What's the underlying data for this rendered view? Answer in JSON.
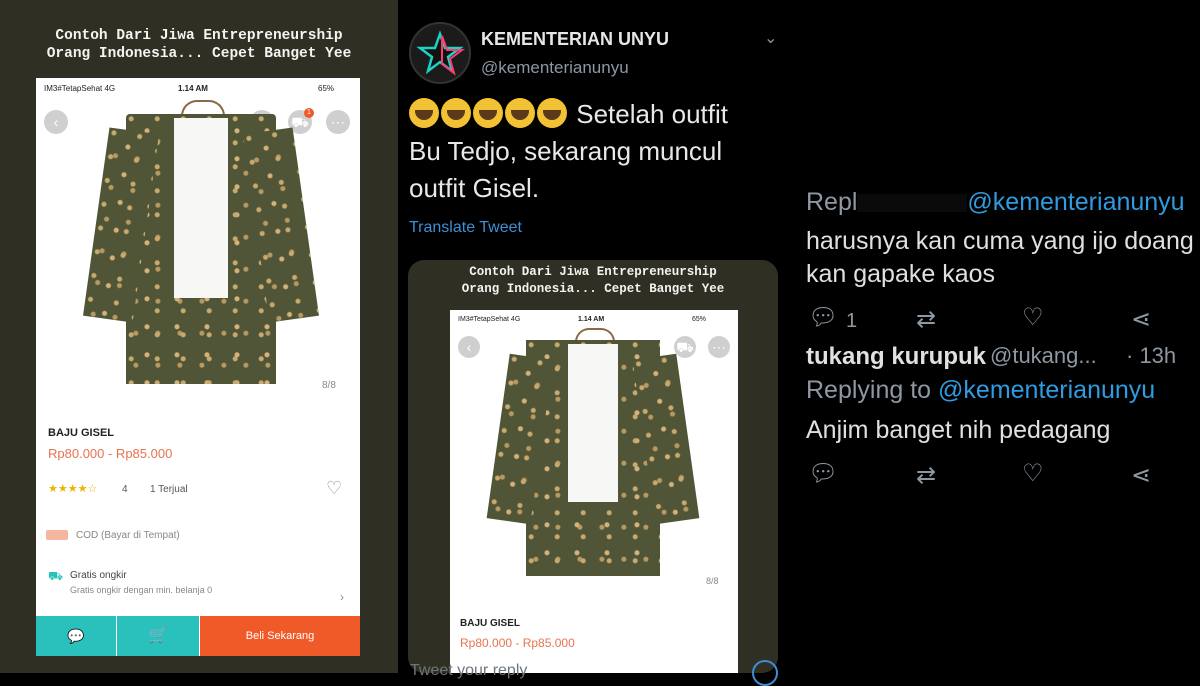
{
  "meme_title": "Contoh Dari Jiwa Entrepreneurship\nOrang Indonesia... Cepet Banget Yee",
  "phone": {
    "status_left": "IM3#TetapSehat  4G",
    "status_time": "1.14 AM",
    "status_battery": "65%",
    "cart_badge": "1",
    "image_index": "8/8",
    "product_name": "BAJU GISEL",
    "price_range": "Rp80.000 - Rp85.000",
    "rating_stars": "★★★★☆",
    "rating_value": "4",
    "sold_count": "1 Terjual",
    "cod_label": "COD (Bayar di Tempat)",
    "free_shipping_title": "Gratis ongkir",
    "free_shipping_desc": "Gratis ongkir dengan min. belanja 0",
    "buy_now_label": "Beli Sekarang",
    "accent": "#f05a28",
    "teal": "#2ac1bc"
  },
  "tweet": {
    "display_name": "KEMENTERIAN UNYU",
    "handle": "@kementerianunyu",
    "text_line1": "Setelah outfit",
    "text_line2": "Bu Tedjo, sekarang muncul",
    "text_line3": "outfit Gisel.",
    "translate_label": "Translate Tweet",
    "reply_placeholder": "Tweet your reply"
  },
  "replies": [
    {
      "replying_prefix": "Repl",
      "replying_to": "@kementerianunyu",
      "text_line1": "harusnya kan cuma yang ijo doang",
      "text_line2": "kan gapake kaos",
      "reply_count": "1"
    },
    {
      "author": "tukang kurupuk",
      "handle": "@tukang...",
      "time": "· 13h",
      "replying_label": "Replying to",
      "replying_to": "@kementerianunyu",
      "text": "Anjim banget nih pedagang"
    }
  ]
}
